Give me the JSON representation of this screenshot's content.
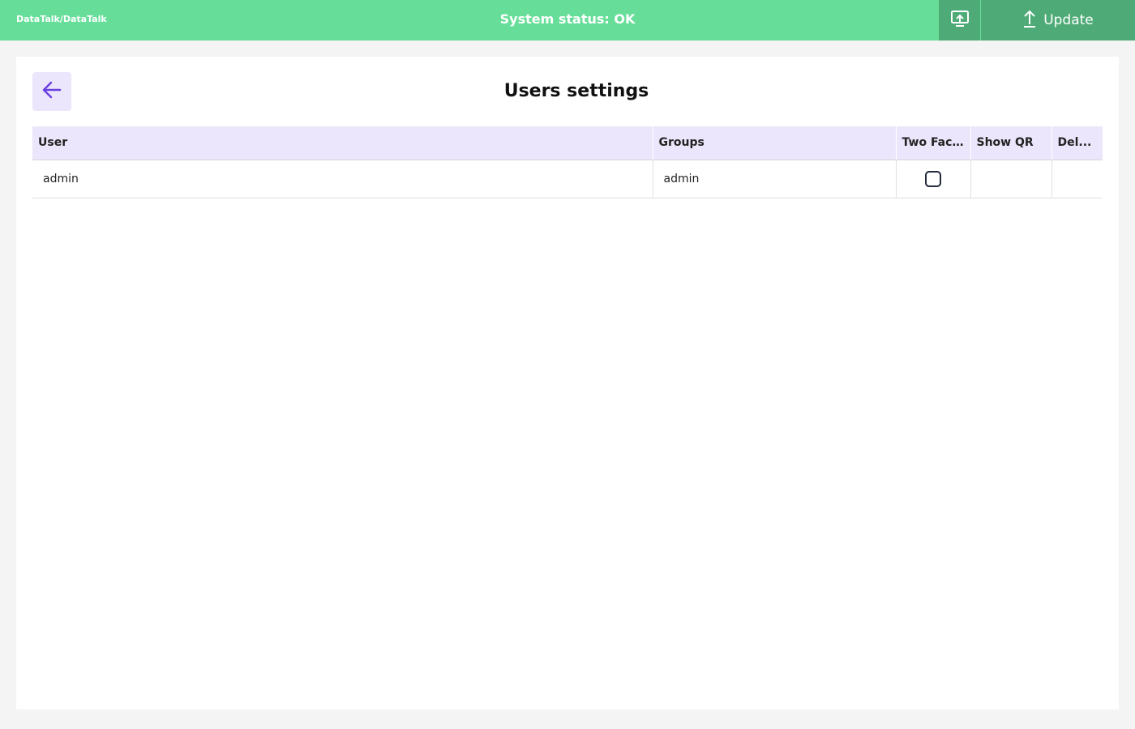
{
  "header": {
    "breadcrumb": "DataTalk/DataTalk",
    "status": "System status: OK",
    "deploy_icon": "monitor-upload-icon",
    "update_label": "Update",
    "update_icon": "upload-arrow-icon"
  },
  "page": {
    "title": "Users settings",
    "back_icon": "arrow-left-icon"
  },
  "table": {
    "columns": [
      "User",
      "Groups",
      "Two Fac...",
      "Show QR",
      "Del..."
    ],
    "rows": [
      {
        "user": "admin",
        "groups": "admin",
        "two_factor": false,
        "show_qr": "",
        "delete": ""
      }
    ]
  },
  "colors": {
    "topbar": "#66de99",
    "topbar_button": "#4eab77",
    "accent": "#6a3fe0",
    "header_row": "#ebe6fb"
  }
}
